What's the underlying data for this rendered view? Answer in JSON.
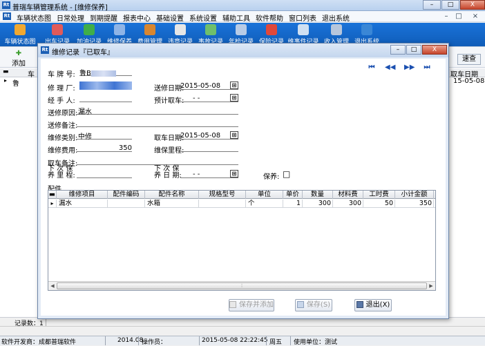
{
  "window": {
    "title": "普瑞车辆管理系统 - [维修保养]",
    "min": "–",
    "max": "□",
    "close": "X"
  },
  "menu": {
    "items": [
      "车辆状态图",
      "日常处理",
      "到期提醒",
      "报表中心",
      "基础设置",
      "系统设置",
      "辅助工具",
      "软件帮助",
      "窗口列表",
      "退出系统"
    ],
    "right": [
      "–",
      "□",
      "×"
    ]
  },
  "toolbar": {
    "items": [
      {
        "label": "车辆状态图",
        "color": "#f0a830"
      },
      {
        "label": "出车记录",
        "color": "#e05a5a"
      },
      {
        "label": "加油记录",
        "color": "#3fae49"
      },
      {
        "label": "维修保养",
        "color": "#8fb4e6"
      },
      {
        "label": "费用管理",
        "color": "#d8862f"
      },
      {
        "label": "违章记录",
        "color": "#e6e6e6"
      },
      {
        "label": "事故记录",
        "color": "#6fbf6b"
      },
      {
        "label": "年检记录",
        "color": "#b7cbe6"
      },
      {
        "label": "保险记录",
        "color": "#e0483b"
      },
      {
        "label": "维事件记录",
        "color": "#cfe0f2"
      },
      {
        "label": "收入管理",
        "color": "#b6c6dc"
      },
      {
        "label": "退出系统",
        "color": "#3a87d6"
      }
    ]
  },
  "background": {
    "add_label": "添加",
    "search_label": "速查",
    "col_right": "取车日期",
    "col_left": "车",
    "row_left": "鲁",
    "row_right": "15-05-08",
    "record_count_label": "记录数：1"
  },
  "dialog": {
    "title": "维修记录『已取车』",
    "nav": [
      "⏮",
      "◀◀",
      "▶▶",
      "⏭"
    ],
    "fields": {
      "plate_label": "车 牌 号:",
      "plate_value": "鲁B",
      "shop_label": "修 理 厂:",
      "send_date_label": "送修日期:",
      "send_date_value": "2015-05-08",
      "handler_label": "经 手 人:",
      "expected_label": "预计取车:",
      "expected_value": "-  -",
      "reason_label": "送修原因:",
      "reason_value": "漏水",
      "send_note_label": "送修备注:",
      "type_label": "维修类别:",
      "type_value": "中修",
      "pickup_date_label": "取车日期:",
      "pickup_date_value": "2015-05-08",
      "cost_label": "维修费用:",
      "cost_value": "350",
      "mileage_label": "维保里程:",
      "pickup_note_label": "取车备注:",
      "next_label_top": "下 次 保",
      "next_label_bottom": "养 里 程:",
      "next_date_top": "下 次 保",
      "next_date_bottom": "养 日 期:",
      "next_date_value": "-  -",
      "maint_label": "保养:",
      "maint_check": "□",
      "cal_icon": "⊞"
    },
    "parts_label": "配件",
    "grid": {
      "headers": [
        "维修项目",
        "配件编码",
        "配件名称",
        "规格型号",
        "单位",
        "单价",
        "数量",
        "材料费",
        "工时费",
        "小计金额"
      ],
      "rows": [
        [
          "漏水",
          "",
          "水箱",
          "",
          "个",
          "1",
          "300",
          "300",
          "50",
          "350"
        ]
      ]
    },
    "buttons": {
      "save_add": "保存并添加",
      "save": "保存(S)",
      "exit": "退出(X)"
    }
  },
  "statusbar": {
    "developer": "软件开发商：成都普瑞软件",
    "version": "2014.08",
    "operator_label": "操作员：",
    "datetime": "2015-05-08 22:22:45",
    "weekday": "周五",
    "unit": "使用单位：测试"
  }
}
